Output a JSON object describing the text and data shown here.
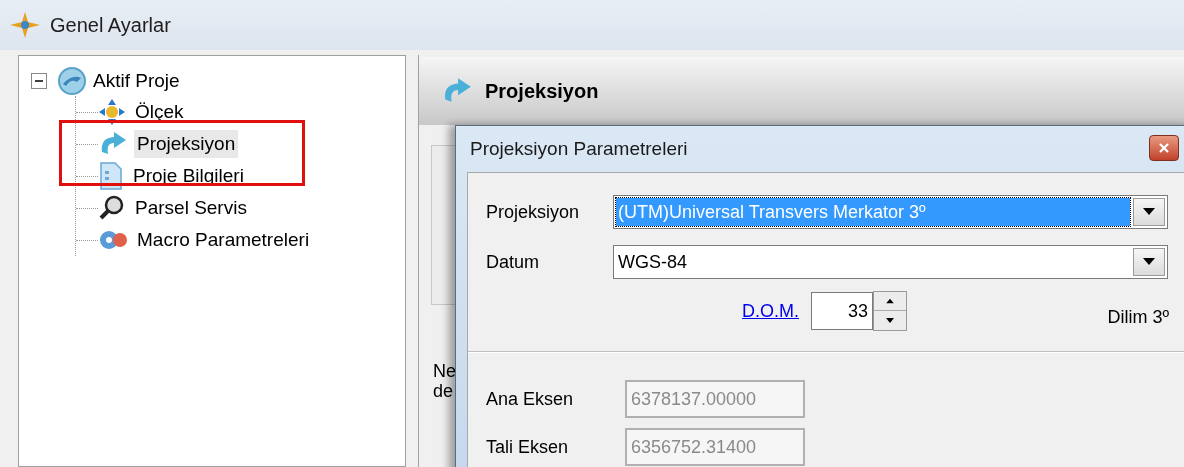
{
  "window": {
    "title": "Genel Ayarlar"
  },
  "tree": {
    "label": "Aktif Proje",
    "expanded": true,
    "children": [
      {
        "label": "Ölçek",
        "selected": false,
        "kind": "scale"
      },
      {
        "label": "Projeksiyon",
        "selected": true,
        "kind": "projection"
      },
      {
        "label": "Proje Bilgileri",
        "selected": false,
        "kind": "info"
      },
      {
        "label": "Parsel Servis",
        "selected": false,
        "kind": "search"
      },
      {
        "label": "Macro Parametreleri",
        "selected": false,
        "kind": "macro"
      }
    ]
  },
  "panel": {
    "title": "Projeksiyon",
    "covered_note": [
      "Ne",
      "de"
    ]
  },
  "dialog": {
    "title": "Projeksiyon Parametreleri",
    "selects": [
      {
        "label": "Projeksiyon",
        "value": "(UTM)Universal Transvers Merkator 3º",
        "selected": true
      },
      {
        "label": "Datum",
        "value": "WGS-84",
        "selected": false
      }
    ],
    "dom": {
      "link": "D.O.M.",
      "value": "33"
    },
    "zone": "Dilim 3º",
    "axes": [
      {
        "label": "Ana Eksen",
        "value": "6378137.00000",
        "disabled": true
      },
      {
        "label": "Tali Eksen",
        "value": "6356752.31400",
        "disabled": true
      }
    ]
  }
}
